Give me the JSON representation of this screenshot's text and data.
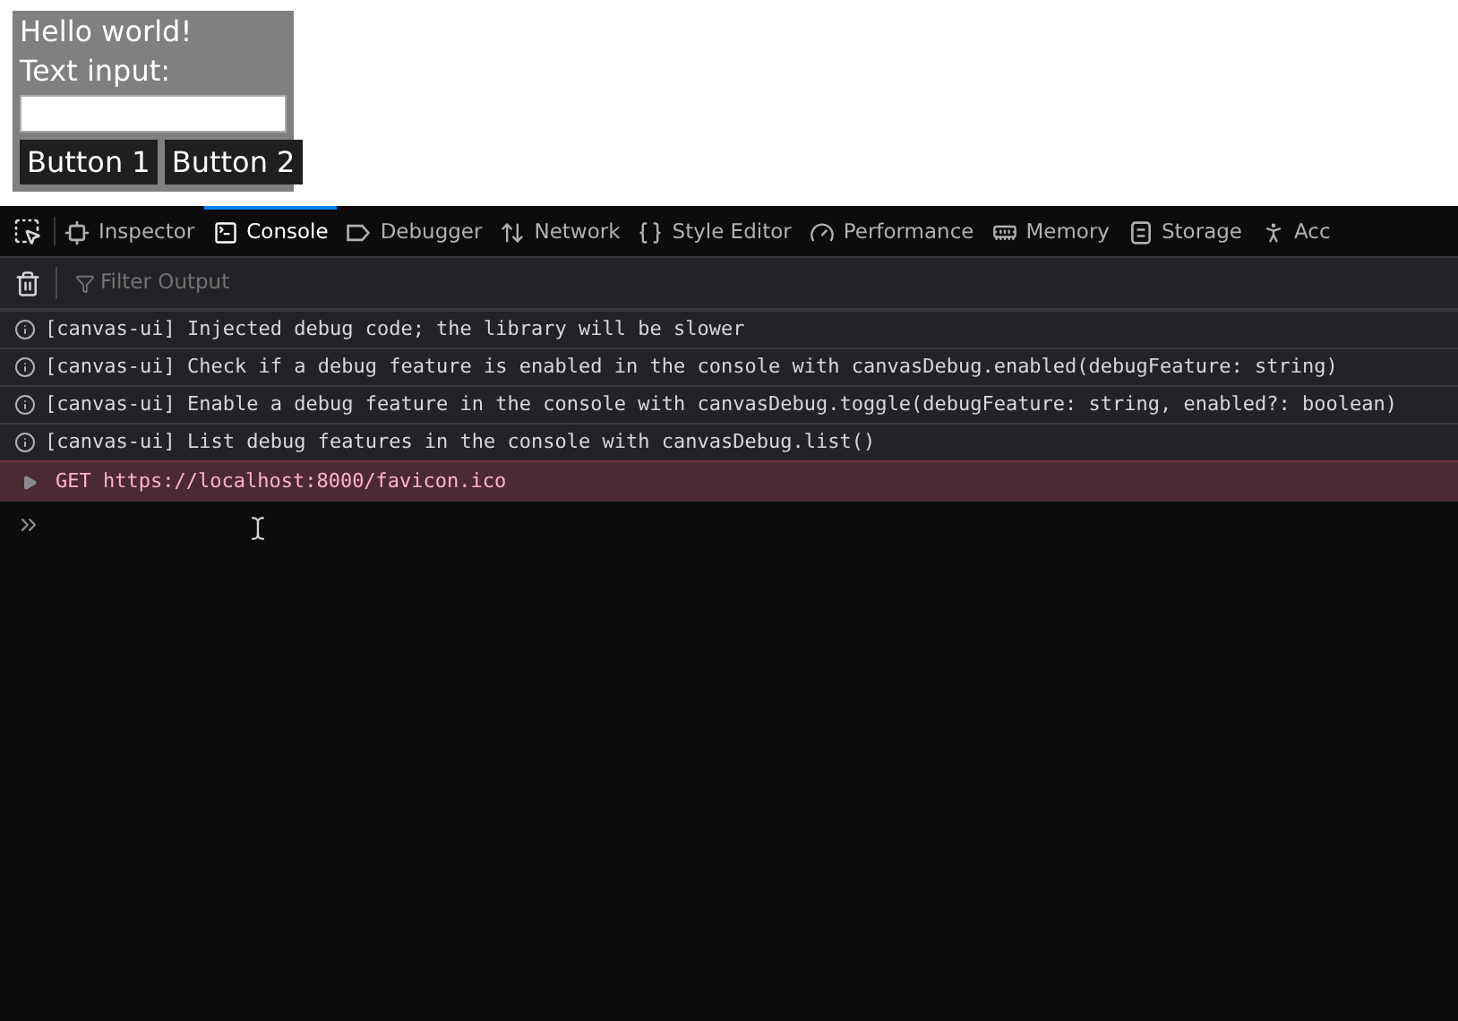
{
  "canvas_ui": {
    "heading": "Hello world!",
    "input_label": "Text input:",
    "buttons": [
      "Button 1",
      "Button 2"
    ]
  },
  "devtools": {
    "tabs": [
      {
        "label": "Inspector",
        "kind": "inspector",
        "selected": false
      },
      {
        "label": "Console",
        "kind": "console",
        "selected": true
      },
      {
        "label": "Debugger",
        "kind": "debugger",
        "selected": false
      },
      {
        "label": "Network",
        "kind": "network",
        "selected": false
      },
      {
        "label": "Style Editor",
        "kind": "style",
        "selected": false
      },
      {
        "label": "Performance",
        "kind": "performance",
        "selected": false
      },
      {
        "label": "Memory",
        "kind": "memory",
        "selected": false
      },
      {
        "label": "Storage",
        "kind": "storage",
        "selected": false
      },
      {
        "label": "Acc",
        "kind": "accessibility",
        "selected": false
      }
    ],
    "filter": {
      "placeholder": "Filter Output"
    },
    "messages": [
      {
        "kind": "info",
        "prefix": "[canvas-ui]",
        "text": "Injected debug code; the library will be slower"
      },
      {
        "kind": "info",
        "prefix": "[canvas-ui]",
        "text": "Check if a debug feature is enabled in the console with canvasDebug.enabled(debugFeature: string)"
      },
      {
        "kind": "info",
        "prefix": "[canvas-ui]",
        "text": "Enable a debug feature in the console with canvasDebug.toggle(debugFeature: string, enabled?: boolean)"
      },
      {
        "kind": "info",
        "prefix": "[canvas-ui]",
        "text": "List debug features in the console with canvasDebug.list()"
      },
      {
        "kind": "error",
        "text": "GET https://localhost:8000/favicon.ico",
        "expanded": false
      }
    ]
  }
}
